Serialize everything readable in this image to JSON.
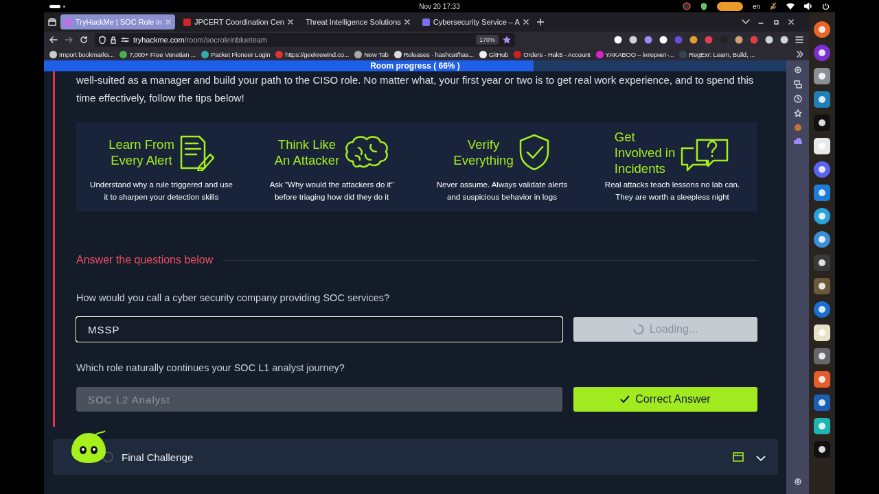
{
  "topbar": {
    "datetime": "Nov 20  17:33",
    "lang": "en"
  },
  "browser": {
    "tabs": [
      {
        "title": "TryHackMe | SOC Role in",
        "selected": true
      },
      {
        "title": "JPCERT Coordination Cen",
        "selected": false
      },
      {
        "title": "Threat Intelligence Solutions",
        "selected": false
      },
      {
        "title": "Cybersecurity Service – A",
        "selected": false
      }
    ],
    "url_host": "tryhackme.com",
    "url_path": "/room/socroleinblueteam",
    "zoom": "170%",
    "bookmarks": [
      "Import bookmarks...",
      "7,000+ Free Venetian ...",
      "Packet Pioneer Login",
      "https://geekrewind.co...",
      "New Tab",
      "Releases · hashcat/has...",
      "GitHub",
      "Orders - Hak5 - Account",
      "YAKABOO – інтернет-...",
      "RegExr: Learn, Build, ..."
    ]
  },
  "page": {
    "progress": {
      "label": "Room progress ( 66% )",
      "level": 0.66
    },
    "intro": "well-suited as a manager and build your path to the CISO role. No matter what, your first year or two is to get real work experience, and to spend this time effectively, follow the tips below!",
    "tips": [
      {
        "kind": "document",
        "title": [
          "Learn From",
          "Every Alert"
        ],
        "text": [
          "Understand why a rule triggered and use",
          "it to sharpen your detection skills"
        ]
      },
      {
        "kind": "brain",
        "title": [
          "Think Like",
          "An Attacker"
        ],
        "text": [
          "Ask \"Why would the attackers do it\"",
          "before triaging how did they do it"
        ]
      },
      {
        "kind": "shield",
        "title": [
          "Verify",
          "Everything"
        ],
        "text": [
          "Never assume. Always validate alerts",
          "and suspicious behavior in logs"
        ]
      },
      {
        "kind": "chat",
        "title": [
          "Get",
          "Involved in",
          "Incidents"
        ],
        "text": [
          "Real attacks teach lessons no lab can.",
          "They are worth a sleepless night"
        ]
      }
    ],
    "answer_heading": "Answer the questions below",
    "questions": [
      {
        "question": "How would you call a cyber security company providing SOC services?",
        "value": "MSSP",
        "focused": true,
        "disabled": false,
        "kind": "loading",
        "button": "Loading..."
      },
      {
        "question": "Which role naturally continues your SOC L1 analyst journey?",
        "value": "SOC L2 Analyst",
        "focused": false,
        "disabled": true,
        "kind": "correct",
        "button": "Correct Answer"
      }
    ],
    "task": {
      "title": "Final Challenge",
      "expanded": false
    }
  }
}
